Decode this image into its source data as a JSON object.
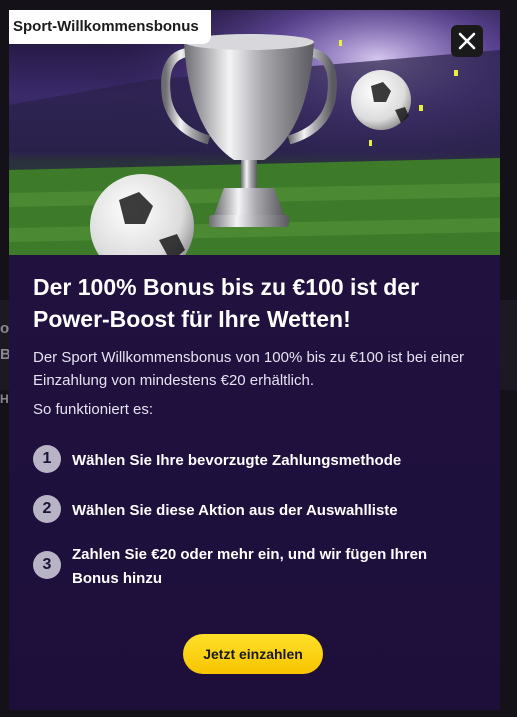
{
  "badge": {
    "label": "Sport-Willkommensbonus"
  },
  "close": {
    "icon": "close-icon"
  },
  "hero": {
    "image": "trophy-football-stadium"
  },
  "title": "Der 100% Bonus bis zu €100 ist der Power-Boost für Ihre Wetten!",
  "description": "Der Sport Willkommensbonus von 100% bis zu €100 ist bei einer Einzahlung von mindestens €20 erhältlich.",
  "how_label": "So funktioniert es:",
  "steps": [
    {
      "number": "1",
      "text": "Wählen Sie Ihre bevorzugte Zahlungsmethode"
    },
    {
      "number": "2",
      "text": "Wählen Sie diese Aktion aus der Auswahlliste"
    },
    {
      "number": "3",
      "text": "Zahlen Sie €20 oder mehr ein, und wir fügen Ihren Bonus hinzu"
    }
  ],
  "cta": {
    "label": "Jetzt einzahlen"
  },
  "colors": {
    "modal_bg": "#1e0f3c",
    "cta": "#ffd814",
    "step_badge": "#b9b3c6"
  }
}
